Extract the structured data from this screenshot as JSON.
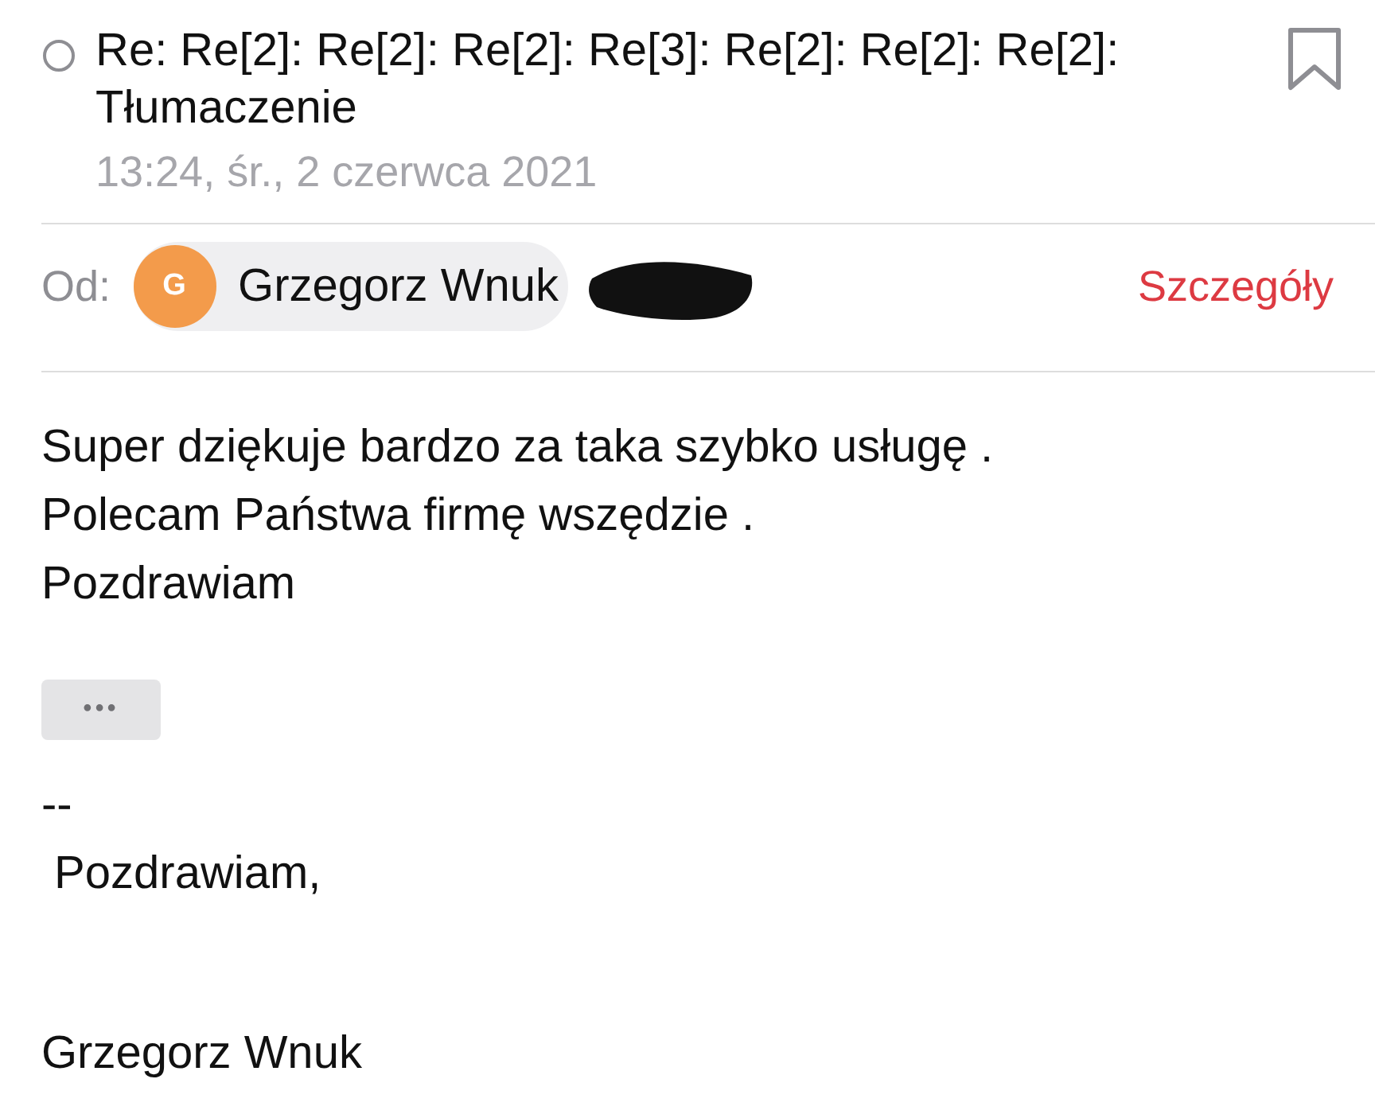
{
  "header": {
    "read_marker": {
      "filled": false
    },
    "subject": "Re: Re[2]: Re[2]: Re[2]: Re[3]: Re[2]: Re[2]: Re[2]: Tłumaczenie",
    "date": "13:24, śr., 2 czerwca 2021",
    "bookmark": {
      "filled": false
    }
  },
  "sender": {
    "label": "Od:",
    "avatar_letter": "G",
    "name": "Grzegorz Wnuk",
    "details_link": "Szczegóły"
  },
  "body": {
    "lines": [
      "Super dziękuje bardzo za taka szybko usługę .",
      "Polecam Państwa firmę wszędzie .",
      "Pozdrawiam"
    ],
    "more_button": "•••"
  },
  "signature": {
    "separator": "--",
    "greeting": " Pozdrawiam,",
    "name": "Grzegorz Wnuk"
  }
}
